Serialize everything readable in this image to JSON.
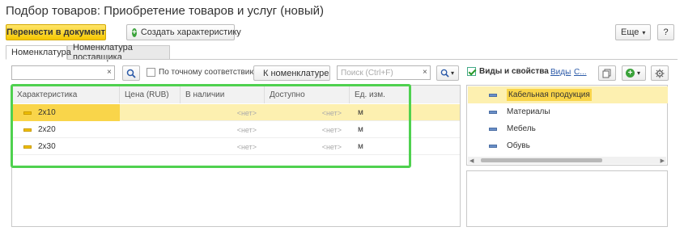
{
  "window": {
    "title": "Подбор товаров: Приобретение товаров и услуг (новый)"
  },
  "toolbar": {
    "transfer_label": "Перенести в документ",
    "create_char_label": "Создать характеристику",
    "more_label": "Еще",
    "help_label": "?"
  },
  "tabs": [
    {
      "label": "Номенклатура",
      "active": true
    },
    {
      "label": "Номенклатура поставщика",
      "active": false
    }
  ],
  "filter": {
    "search_value": "",
    "clear_label": "×",
    "exact_match_label": "По точному соответствию",
    "to_nomenclature_label": "К номенклатуре",
    "search_placeholder": "Поиск (Ctrl+F)",
    "search_clear_label": "×"
  },
  "table": {
    "columns": [
      "Характеристика",
      "Цена (RUB)",
      "В наличии",
      "Доступно",
      "Ед. изм."
    ],
    "rows": [
      {
        "name": "2x10",
        "price": "",
        "in_stock": "<нет>",
        "available": "<нет>",
        "unit": "м",
        "selected": true
      },
      {
        "name": "2x20",
        "price": "",
        "in_stock": "<нет>",
        "available": "<нет>",
        "unit": "м",
        "selected": false
      },
      {
        "name": "2x30",
        "price": "",
        "in_stock": "<нет>",
        "available": "<нет>",
        "unit": "м",
        "selected": false
      }
    ]
  },
  "right_panel": {
    "types_label": "Виды и свойства",
    "link_types": "Виды",
    "link_c": "С...",
    "groups": [
      "Кабельная продукция",
      "Материалы",
      "Мебель",
      "Обувь"
    ],
    "selected_group": 0
  },
  "colors": {
    "accent_yellow": "#f6c800",
    "highlight_frame": "#4fd14f",
    "selected_row": "#fdf0b0"
  },
  "icons": [
    "search-icon",
    "arrow-left-icon",
    "plus-icon",
    "copy-icon",
    "gear-icon",
    "checkbox-icon"
  ]
}
